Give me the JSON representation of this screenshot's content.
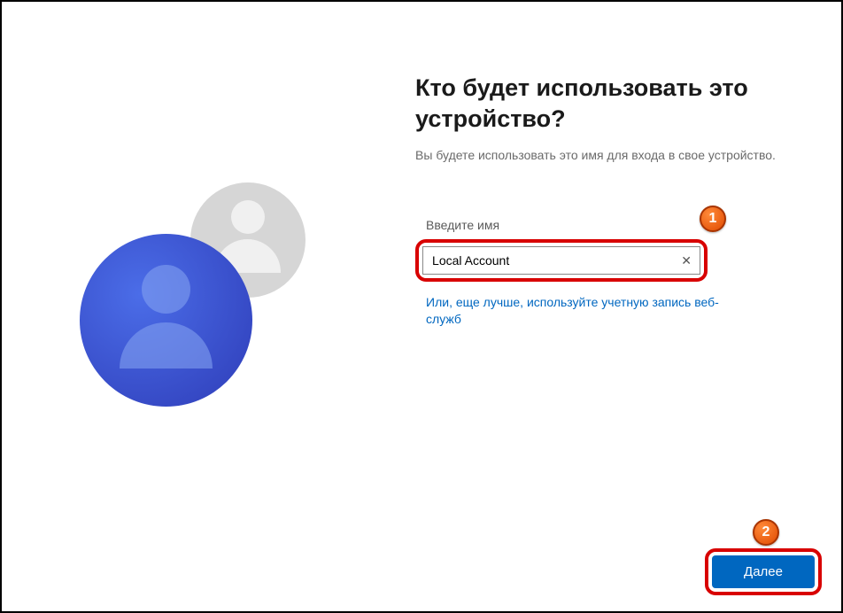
{
  "content": {
    "heading": "Кто будет использовать это устройство?",
    "subtitle": "Вы будете использовать это имя для входа в свое устройство.",
    "fieldLabel": "Введите имя",
    "inputValue": "Local Account",
    "linkText": "Или, еще лучше, используйте учетную запись веб-служб",
    "nextButton": "Далее"
  },
  "annotations": {
    "badge1": "1",
    "badge2": "2"
  },
  "colors": {
    "primaryButton": "#0067c0",
    "link": "#0067c0",
    "highlight": "#d80000",
    "badge": "#e04a00"
  }
}
